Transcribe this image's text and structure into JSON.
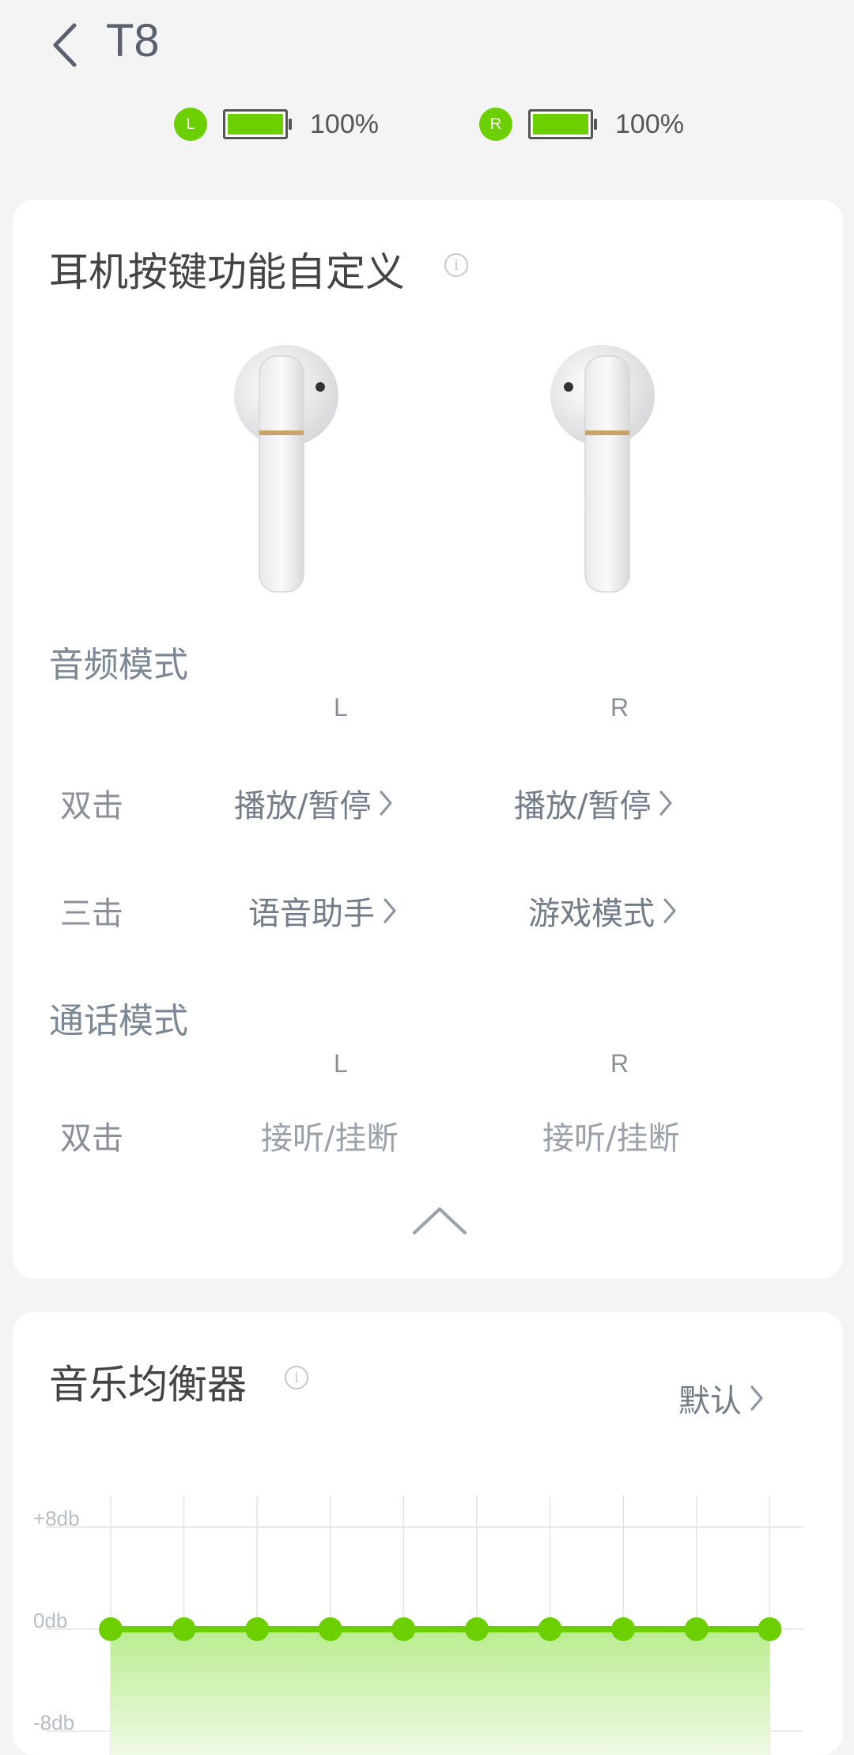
{
  "header": {
    "title": "T8",
    "back_icon": "chevron-left-icon"
  },
  "battery": {
    "left": {
      "badge": "L",
      "percent_text": "100%",
      "level": 1.0
    },
    "right": {
      "badge": "R",
      "percent_text": "100%",
      "level": 1.0
    },
    "color": "#6cd000"
  },
  "custom_keys": {
    "title": "耳机按键功能自定义",
    "audio_mode": {
      "title": "音频模式",
      "col_left": "L",
      "col_right": "R",
      "rows": [
        {
          "label": "双击",
          "left": "播放/暂停",
          "right": "播放/暂停"
        },
        {
          "label": "三击",
          "left": "语音助手",
          "right": "游戏模式"
        }
      ]
    },
    "call_mode": {
      "title": "通话模式",
      "col_left": "L",
      "col_right": "R",
      "rows": [
        {
          "label": "双击",
          "left": "接听/挂断",
          "right": "接听/挂断"
        }
      ]
    }
  },
  "equalizer": {
    "title": "音乐均衡器",
    "preset_label": "默认",
    "y_labels": [
      "+8db",
      "0db",
      "-8db"
    ],
    "bands": 10,
    "gains_db": [
      0,
      0,
      0,
      0,
      0,
      0,
      0,
      0,
      0,
      0
    ],
    "accent": "#6cd000"
  }
}
